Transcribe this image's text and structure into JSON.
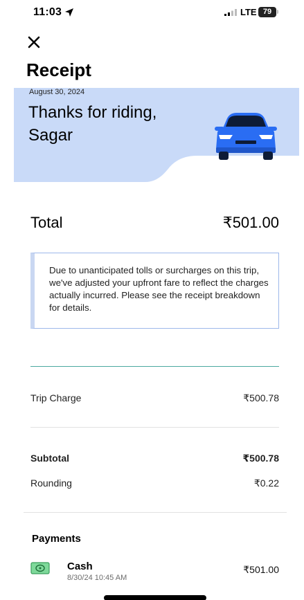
{
  "status_bar": {
    "time": "11:03",
    "network": "LTE",
    "battery": "79"
  },
  "header": {
    "title": "Receipt"
  },
  "hero": {
    "date": "August 30, 2024",
    "message": "Thanks for riding, Sagar"
  },
  "total": {
    "label": "Total",
    "value": "₹501.00"
  },
  "notice": {
    "text": "Due to unanticipated tolls or surcharges on this trip, we've adjusted your upfront fare to reflect the charges actually incurred. Please see the receipt breakdown for details."
  },
  "breakdown": {
    "trip_charge": {
      "label": "Trip Charge",
      "value": "₹500.78"
    },
    "subtotal": {
      "label": "Subtotal",
      "value": "₹500.78"
    },
    "rounding": {
      "label": "Rounding",
      "value": "₹0.22"
    }
  },
  "payments": {
    "title": "Payments",
    "method": "Cash",
    "timestamp": "8/30/24 10:45 AM",
    "amount": "₹501.00"
  },
  "colors": {
    "hero_bg": "#c9daf8",
    "car": "#2a6df3",
    "notice_border": "#9db8ea",
    "divider_accent": "#4aa9a0"
  }
}
